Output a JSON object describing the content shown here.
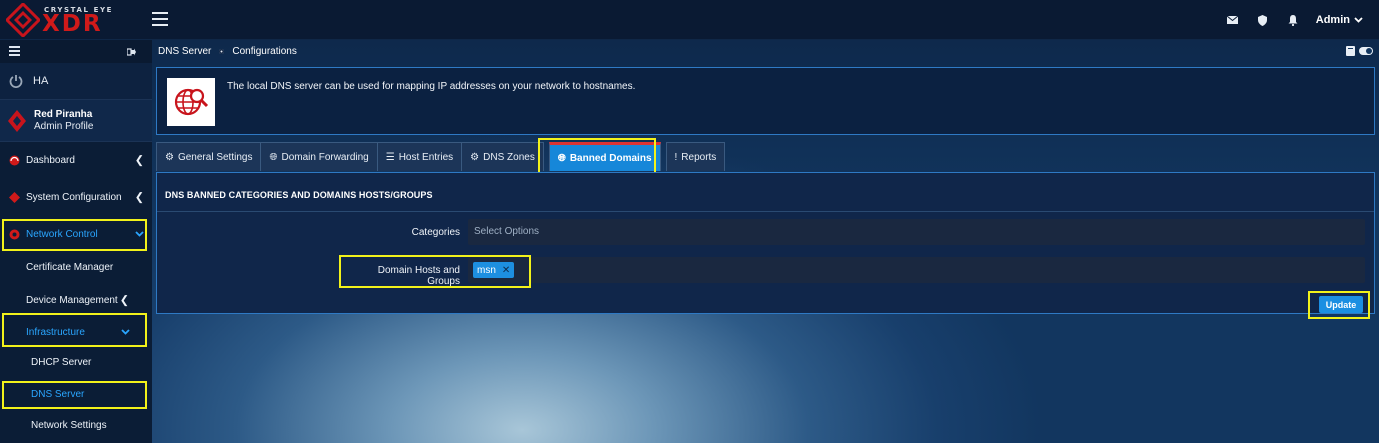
{
  "brand": {
    "top": "CRYSTAL EYE",
    "main": "XDR",
    "accent": "#d01a1a"
  },
  "topbar": {
    "admin_label": "Admin",
    "icons": [
      "envelope-icon",
      "shield-icon",
      "bell-icon",
      "chevron-down-icon"
    ]
  },
  "sidebar": {
    "ha_label": "HA",
    "profile": {
      "name": "Red Piranha",
      "role": "Admin Profile"
    },
    "items": [
      {
        "label": "Dashboard"
      },
      {
        "label": "System Configuration"
      },
      {
        "label": "Network Control"
      },
      {
        "label": "Certificate Manager"
      },
      {
        "label": "Device Management"
      },
      {
        "label": "Infrastructure"
      },
      {
        "label": "DHCP Server"
      },
      {
        "label": "DNS Server"
      },
      {
        "label": "Network Settings"
      }
    ]
  },
  "breadcrumb": {
    "first": "DNS Server",
    "second": "Configurations"
  },
  "info": {
    "text": "The local DNS server can be used for mapping IP addresses on your network to hostnames."
  },
  "tabs": [
    {
      "label": "General Settings"
    },
    {
      "label": "Domain Forwarding"
    },
    {
      "label": "Host Entries"
    },
    {
      "label": "DNS Zones"
    },
    {
      "label": "Banned Domains"
    },
    {
      "label": "Reports"
    }
  ],
  "panel": {
    "title": "DNS BANNED CATEGORIES AND DOMAINS HOSTS/GROUPS",
    "categories_label": "Categories",
    "categories_placeholder": "Select Options",
    "hosts_label": "Domain Hosts and Groups",
    "hosts_tag": "msn",
    "update_label": "Update"
  },
  "colors": {
    "highlight": "#f2f21a",
    "active_tab": "#1687d9",
    "active_nav": "#2aa6ff"
  }
}
